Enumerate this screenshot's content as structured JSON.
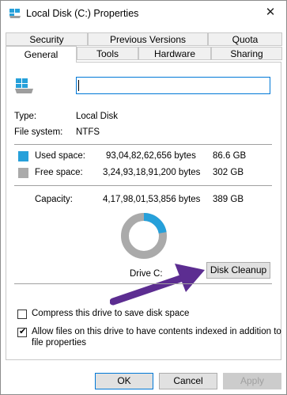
{
  "window": {
    "title": "Local Disk (C:) Properties",
    "close_glyph": "✕"
  },
  "tabs": {
    "row1": [
      "Security",
      "Previous Versions",
      "Quota"
    ],
    "row2": [
      "General",
      "Tools",
      "Hardware",
      "Sharing"
    ],
    "active": "General"
  },
  "general": {
    "name_value": "",
    "type_label": "Type:",
    "type_value": "Local Disk",
    "fs_label": "File system:",
    "fs_value": "NTFS",
    "used": {
      "label": "Used space:",
      "bytes": "93,04,82,62,656 bytes",
      "size": "86.6 GB",
      "color": "#26a0da"
    },
    "free": {
      "label": "Free space:",
      "bytes": "3,24,93,18,91,200 bytes",
      "size": "302 GB",
      "color": "#aaaaaa"
    },
    "capacity": {
      "label": "Capacity:",
      "bytes": "4,17,98,01,53,856 bytes",
      "size": "389 GB"
    },
    "used_fraction": 0.223,
    "drive_label": "Drive C:",
    "cleanup_button": "Disk Cleanup",
    "compress_label": "Compress this drive to save disk space",
    "compress_checked": false,
    "index_label_line1": "Allow files on this drive to have contents indexed in addition to",
    "index_label_line2": "file properties",
    "index_checked": true
  },
  "footer": {
    "ok": "OK",
    "cancel": "Cancel",
    "apply": "Apply"
  },
  "colors": {
    "accent": "#0078d7",
    "arrow": "#5c2d91"
  }
}
